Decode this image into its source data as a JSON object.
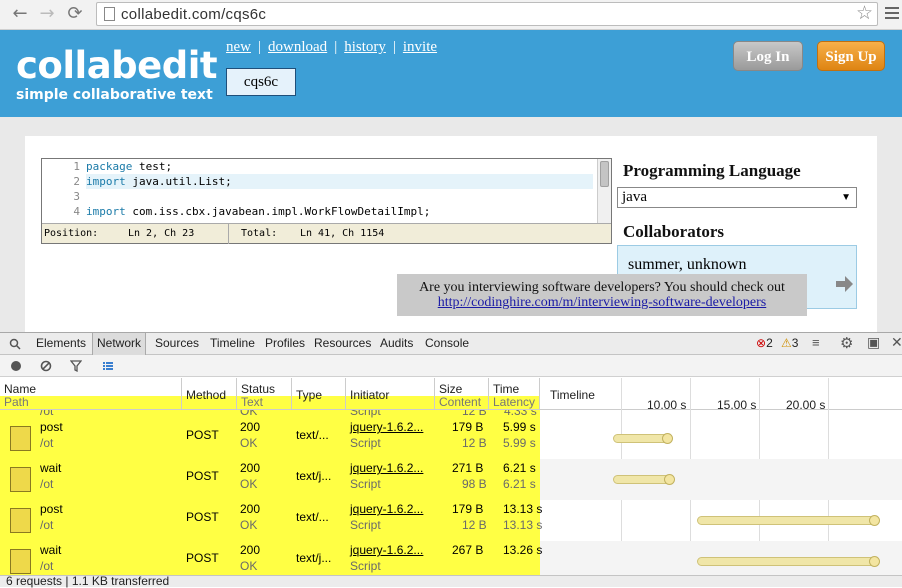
{
  "browser": {
    "url": "collabedit.com/cqs6c"
  },
  "site": {
    "logo": "collabedit",
    "tagline": "simple collaborative text",
    "nav": [
      "new",
      "download",
      "history",
      "invite"
    ],
    "nav_sep": "|",
    "document_id": "cqs6c",
    "login_label": "Log In",
    "signup_label": "Sign Up"
  },
  "editor": {
    "line_numbers": [
      "1",
      "2",
      "3",
      "4"
    ],
    "lines": [
      {
        "kw": "package",
        "rest": " test;"
      },
      {
        "kw": "import",
        "rest": " java.util.List;"
      },
      {
        "kw": "",
        "rest": ""
      },
      {
        "kw": "import",
        "rest": " com.iss.cbx.javabean.impl.WorkFlowDetailImpl;"
      }
    ],
    "position_label": "Position:",
    "position_value": "Ln 2, Ch 23",
    "total_label": "Total:",
    "total_value": "Ln 41, Ch 1154"
  },
  "panel": {
    "lang_title": "Programming Language",
    "lang_value": "java",
    "collab_title": "Collaborators",
    "collaborators": "summer, unknown"
  },
  "ad": {
    "text": "Are you interviewing software developers? You should check out ",
    "link": "http://codinghire.com/m/interviewing-software-developers"
  },
  "devtools": {
    "tabs": [
      "Elements",
      "Network",
      "Sources",
      "Timeline",
      "Profiles",
      "Resources",
      "Audits",
      "Console"
    ],
    "active_tab": "Network",
    "errors": "2",
    "warnings": "3",
    "columns": {
      "name": "Name",
      "path": "Path",
      "method": "Method",
      "status": "Status",
      "text": "Text",
      "type": "Type",
      "initiator": "Initiator",
      "size": "Size",
      "content": "Content",
      "time": "Time",
      "latency": "Latency",
      "timeline": "Timeline"
    },
    "timeline_ticks": [
      "10.00 s",
      "15.00 s",
      "20.00 s"
    ],
    "partial_row": {
      "path": "/ot",
      "text": "OK",
      "initiator": "Script",
      "content": "12 B",
      "latency": "4.33 s"
    },
    "rows": [
      {
        "name": "post",
        "path": "/ot",
        "method": "POST",
        "status": "200",
        "text": "OK",
        "type": "text/...",
        "initiator": "jquery-1.6.2...",
        "init_sub": "Script",
        "size": "179 B",
        "content": "12 B",
        "time": "5.99 s",
        "latency": "5.99 s",
        "bar_start": 5.99,
        "bar_end": 10.3
      },
      {
        "name": "wait",
        "path": "/ot",
        "method": "POST",
        "status": "200",
        "text": "OK",
        "type": "text/j...",
        "initiator": "jquery-1.6.2...",
        "init_sub": "Script",
        "size": "271 B",
        "content": "98 B",
        "time": "6.21 s",
        "latency": "6.21 s",
        "bar_start": 5.99,
        "bar_end": 10.4
      },
      {
        "name": "post",
        "path": "/ot",
        "method": "POST",
        "status": "200",
        "text": "OK",
        "type": "text/...",
        "initiator": "jquery-1.6.2...",
        "init_sub": "Script",
        "size": "179 B",
        "content": "12 B",
        "time": "13.13 s",
        "latency": "13.13 s",
        "bar_start": 12.1,
        "bar_end": 25.3
      },
      {
        "name": "wait",
        "path": "/ot",
        "method": "POST",
        "status": "200",
        "text": "OK",
        "type": "text/j...",
        "initiator": "jquery-1.6.2...",
        "init_sub": "Script",
        "size": "267 B",
        "content": "",
        "time": "13.26 s",
        "latency": "",
        "bar_start": 12.1,
        "bar_end": 25.3
      }
    ],
    "status_text": "6 requests  |  1.1 KB transferred",
    "colors": {
      "highlight": "#ffff44",
      "bar": "#f0e6a8"
    }
  }
}
